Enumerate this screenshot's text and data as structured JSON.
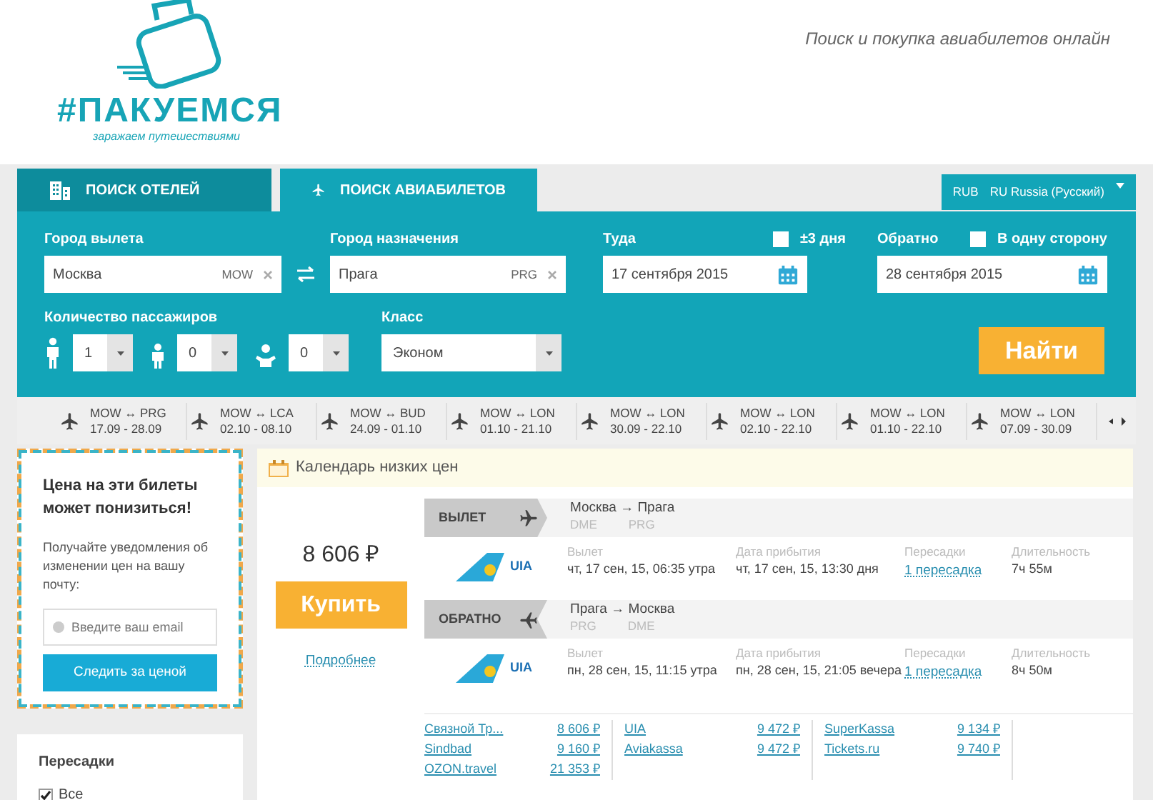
{
  "header": {
    "logo_title": "#ПАКУЕМСЯ",
    "logo_tagline": "заражаем путешествиями",
    "slogan": "Поиск и покупка авиабилетов онлайн"
  },
  "tabs": [
    {
      "label": "ПОИСК ОТЕЛЕЙ",
      "kind": "hotel",
      "selected": false
    },
    {
      "label": "ПОИСК АВИАБИЛЕТОВ",
      "kind": "plane",
      "selected": true
    }
  ],
  "locale": {
    "currency": "RUB",
    "language": "RU Russia (Русский)"
  },
  "search": {
    "origin": {
      "label": "Город вылета",
      "value": "Москва",
      "code": "MOW"
    },
    "destination": {
      "label": "Город назначения",
      "value": "Прага",
      "code": "PRG"
    },
    "depart": {
      "label": "Туда",
      "value": "17 сентября 2015",
      "option": {
        "label": "±3 дня",
        "checked": false
      }
    },
    "return": {
      "label": "Обратно",
      "value": "28 сентября 2015",
      "option": {
        "label": "В одну сторону",
        "checked": false
      }
    },
    "passengers_label": "Количество пассажиров",
    "passengers": [
      {
        "kind": "adult",
        "value": "1"
      },
      {
        "kind": "child",
        "value": "0"
      },
      {
        "kind": "infant",
        "value": "0"
      }
    ],
    "class": {
      "label": "Класс",
      "value": "Эконом"
    },
    "submit": "Найти"
  },
  "recent_routes": [
    {
      "route": "MOW ↔ PRG",
      "dates": "17.09 - 28.09"
    },
    {
      "route": "MOW ↔ LCA",
      "dates": "02.10 - 08.10"
    },
    {
      "route": "MOW ↔ BUD",
      "dates": "24.09 - 01.10"
    },
    {
      "route": "MOW ↔ LON",
      "dates": "01.10 - 21.10"
    },
    {
      "route": "MOW ↔ LON",
      "dates": "30.09 - 22.10"
    },
    {
      "route": "MOW ↔ LON",
      "dates": "02.10 - 22.10"
    },
    {
      "route": "MOW ↔ LON",
      "dates": "01.10 - 22.10"
    },
    {
      "route": "MOW ↔ LON",
      "dates": "07.09 - 30.09"
    }
  ],
  "subscribe": {
    "title": "Цена на эти билеты может понизиться!",
    "text": "Получайте уведомления об изменении цен на вашу почту:",
    "placeholder": "Введите ваш email",
    "button": "Следить за ценой"
  },
  "filters": {
    "title": "Пересадки",
    "options": [
      {
        "label": "Все",
        "checked": true
      }
    ]
  },
  "calendar": {
    "label": "Календарь низких цен"
  },
  "offer": {
    "price": "8 606 ₽",
    "buy": "Купить",
    "details": "Подробнее",
    "legs": [
      {
        "kind": "outbound",
        "direction": "ВЫЛЕТ",
        "route": "Москва → Прага",
        "from_code": "DME",
        "to_code": "PRG",
        "airline": "UIA",
        "depart_label": "Вылет",
        "depart": "чт, 17 сен, 15, 06:35 утра",
        "arrive_label": "Дата прибытия",
        "arrive": "чт, 17 сен, 15, 13:30 дня",
        "stops_label": "Пересадки",
        "stops": "1 пересадка",
        "duration_label": "Длительность",
        "duration": "7ч 55м"
      },
      {
        "kind": "return",
        "direction": "ОБРАТНО",
        "route": "Прага → Москва",
        "from_code": "PRG",
        "to_code": "DME",
        "airline": "UIA",
        "depart_label": "Вылет",
        "depart": "пн, 28 сен, 15, 11:15 утра",
        "arrive_label": "Дата прибытия",
        "arrive": "пн, 28 сен, 15, 21:05 вечера",
        "stops_label": "Пересадки",
        "stops": "1 пересадка",
        "duration_label": "Длительность",
        "duration": "8ч 50м"
      }
    ],
    "agencies": [
      [
        {
          "name": "Связной Тр...",
          "price": "8 606 ₽"
        },
        {
          "name": "Sindbad",
          "price": "9 160 ₽"
        },
        {
          "name": "OZON.travel",
          "price": "21 353 ₽"
        }
      ],
      [
        {
          "name": "UIA",
          "price": "9 472 ₽"
        },
        {
          "name": "Aviakassa",
          "price": "9 472 ₽"
        }
      ],
      [
        {
          "name": "SuperKassa",
          "price": "9 134 ₽"
        },
        {
          "name": "Tickets.ru",
          "price": "9 740 ₽"
        }
      ]
    ]
  }
}
